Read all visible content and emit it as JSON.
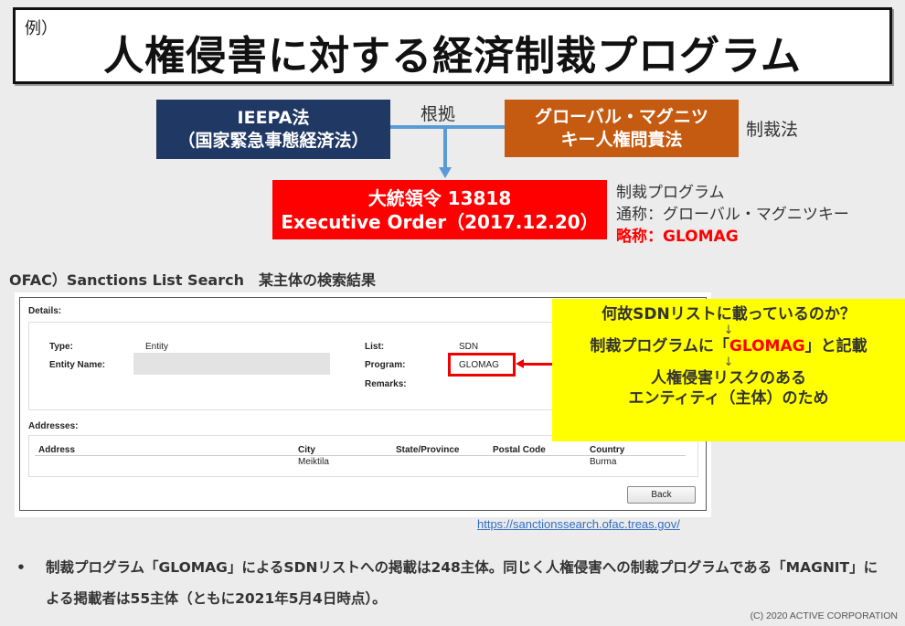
{
  "title": {
    "prefix": "例）",
    "main": "人権侵害に対する経済制裁プログラム"
  },
  "diagram": {
    "ieepa": {
      "line1": "IEEPA法",
      "line2": "（国家緊急事態経済法）"
    },
    "magnitsky": {
      "line1": "グローバル・マグニツ",
      "line2": "キー人権問責法"
    },
    "basis_label": "根拠",
    "sanction_law_label": "制裁法",
    "executive_order": {
      "line1": "大統領令 13818",
      "line2": "Executive Order（2017.12.20）"
    },
    "program_info": {
      "line1": "制裁プログラム",
      "line2": "通称：グローバル・マグニツキー",
      "line3": "略称：GLOMAG"
    },
    "colors": {
      "ieepa": "#1f3864",
      "magnitsky": "#c55a11",
      "executive_order": "#ff0000",
      "connector": "#5b9bd5"
    }
  },
  "ofac_heading": "OFAC）Sanctions List Search　某主体の検索結果",
  "search_result": {
    "details_label": "Details:",
    "type_label": "Type:",
    "type_value": "Entity",
    "entity_name_label": "Entity Name:",
    "entity_name_value": "",
    "list_label": "List:",
    "list_value": "SDN",
    "program_label": "Program:",
    "program_value": "GLOMAG",
    "remarks_label": "Remarks:",
    "remarks_value": "",
    "addresses_label": "Addresses:",
    "address_columns": [
      "Address",
      "City",
      "State/Province",
      "Postal Code",
      "Country"
    ],
    "address_rows": [
      {
        "address": "",
        "city": "Meiktila",
        "state": "",
        "postal": "",
        "country": "Burma"
      }
    ],
    "back_button": "Back"
  },
  "callout": {
    "line1": "何故SDNリストに載っているのか？",
    "arrow1": "↓",
    "line2_pre": "制裁プログラムに「",
    "line2_highlight": "GLOMAG",
    "line2_post": "」と記載",
    "arrow2": "↓",
    "line3": "人権侵害リスクのある",
    "line4": "エンティティ（主体）のため"
  },
  "source_url": "https://sanctionssearch.ofac.treas.gov/",
  "bullet": {
    "dot": "•",
    "text": "制裁プログラム「GLOMAG」によるSDNリストへの掲載は248主体。同じく人権侵害への制裁プログラムである「MAGNIT」による掲載者は55主体（ともに2021年5月4日時点）。"
  },
  "copyright": "(C) 2020 ACTIVE CORPORATION"
}
